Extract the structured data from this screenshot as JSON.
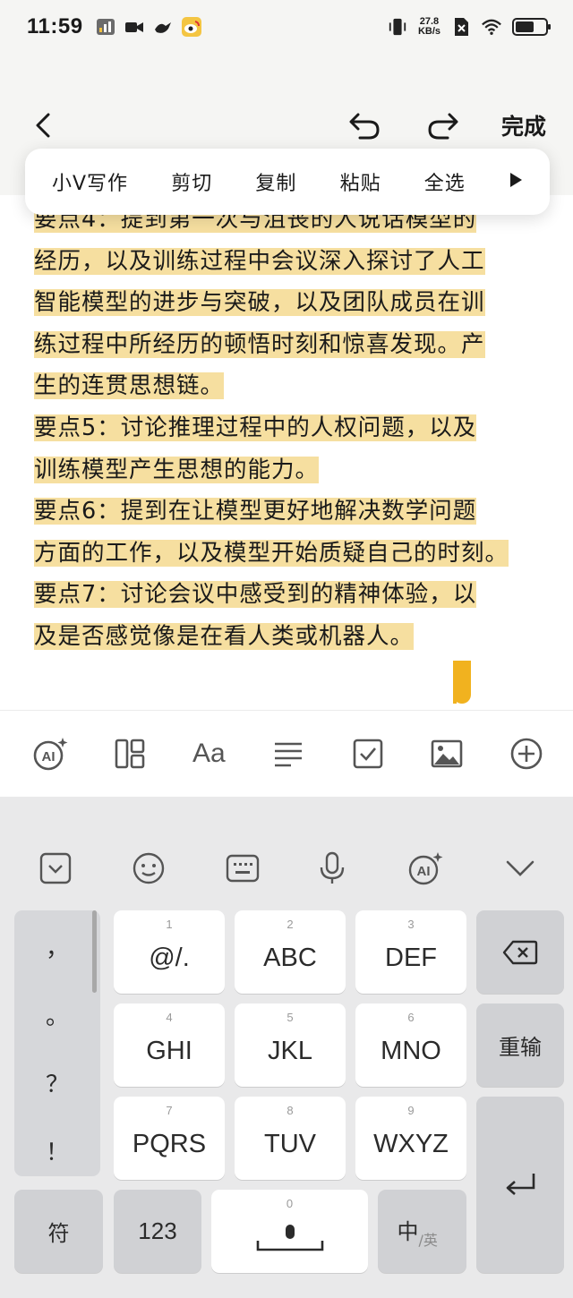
{
  "status_bar": {
    "time": "11:59",
    "speed_value": "27.8",
    "speed_unit": "KB/s",
    "battery_level": 0.62
  },
  "header": {
    "done_label": "完成"
  },
  "context_menu": {
    "items": [
      "小V写作",
      "剪切",
      "复制",
      "粘贴",
      "全选"
    ]
  },
  "editor": {
    "lines": [
      "要点4：提到第一次与沮丧的人说话模型的",
      "经历，以及训练过程中会议深入探讨了人工",
      "智能模型的进步与突破，以及团队成员在训",
      "练过程中所经历的顿悟时刻和惊喜发现。产",
      "生的连贯思想链。",
      "要点5：讨论推理过程中的人权问题，以及",
      "训练模型产生思想的能力。",
      "要点6：提到在让模型更好地解决数学问题",
      "方面的工作，以及模型开始质疑自己的时刻。",
      "要点7：讨论会议中感受到的精神体验，以",
      "及是否感觉像是在看人类或机器人。"
    ],
    "selection_color": "#f6dfa0",
    "handle_color": "#f1b21f"
  },
  "format_toolbar": {
    "ai_label": "AI",
    "text_style_label": "Aa"
  },
  "keyboard": {
    "top_ai_label": "AI",
    "punctuation": [
      "，",
      "。",
      "？",
      "！"
    ],
    "keys": {
      "k1": {
        "num": "1",
        "label": "@/."
      },
      "k2": {
        "num": "2",
        "label": "ABC"
      },
      "k3": {
        "num": "3",
        "label": "DEF"
      },
      "k4": {
        "num": "4",
        "label": "GHI"
      },
      "k5": {
        "num": "5",
        "label": "JKL"
      },
      "k6": {
        "num": "6",
        "label": "MNO"
      },
      "k7": {
        "num": "7",
        "label": "PQRS"
      },
      "k8": {
        "num": "8",
        "label": "TUV"
      },
      "k9": {
        "num": "9",
        "label": "WXYZ"
      },
      "k0": {
        "num": "0"
      }
    },
    "reenter_label": "重输",
    "symbol_label": "符",
    "numbers_label": "123",
    "lang_main": "中",
    "lang_sub": "/英"
  }
}
